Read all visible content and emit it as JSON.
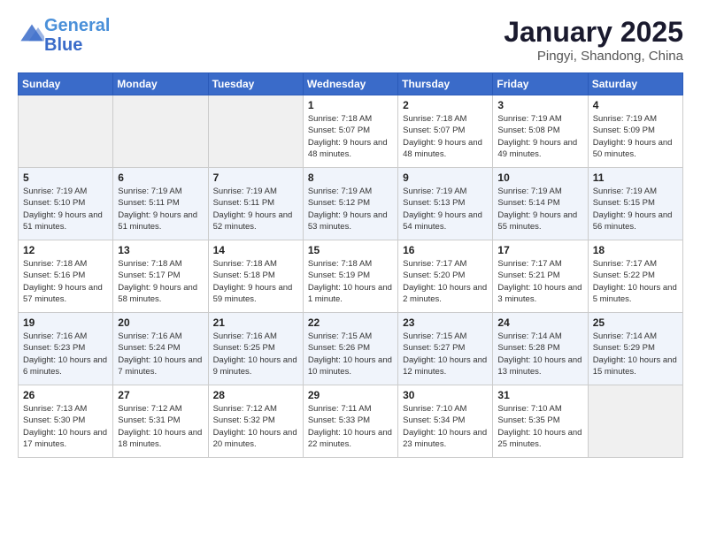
{
  "header": {
    "logo_line1": "General",
    "logo_line2": "Blue",
    "month": "January 2025",
    "location": "Pingyi, Shandong, China"
  },
  "days_of_week": [
    "Sunday",
    "Monday",
    "Tuesday",
    "Wednesday",
    "Thursday",
    "Friday",
    "Saturday"
  ],
  "weeks": [
    [
      {
        "day": "",
        "empty": true
      },
      {
        "day": "",
        "empty": true
      },
      {
        "day": "",
        "empty": true
      },
      {
        "day": "1",
        "sunrise": "7:18 AM",
        "sunset": "5:07 PM",
        "daylight": "9 hours and 48 minutes."
      },
      {
        "day": "2",
        "sunrise": "7:18 AM",
        "sunset": "5:07 PM",
        "daylight": "9 hours and 48 minutes."
      },
      {
        "day": "3",
        "sunrise": "7:19 AM",
        "sunset": "5:08 PM",
        "daylight": "9 hours and 49 minutes."
      },
      {
        "day": "4",
        "sunrise": "7:19 AM",
        "sunset": "5:09 PM",
        "daylight": "9 hours and 50 minutes."
      }
    ],
    [
      {
        "day": "5",
        "sunrise": "7:19 AM",
        "sunset": "5:10 PM",
        "daylight": "9 hours and 51 minutes."
      },
      {
        "day": "6",
        "sunrise": "7:19 AM",
        "sunset": "5:11 PM",
        "daylight": "9 hours and 51 minutes."
      },
      {
        "day": "7",
        "sunrise": "7:19 AM",
        "sunset": "5:11 PM",
        "daylight": "9 hours and 52 minutes."
      },
      {
        "day": "8",
        "sunrise": "7:19 AM",
        "sunset": "5:12 PM",
        "daylight": "9 hours and 53 minutes."
      },
      {
        "day": "9",
        "sunrise": "7:19 AM",
        "sunset": "5:13 PM",
        "daylight": "9 hours and 54 minutes."
      },
      {
        "day": "10",
        "sunrise": "7:19 AM",
        "sunset": "5:14 PM",
        "daylight": "9 hours and 55 minutes."
      },
      {
        "day": "11",
        "sunrise": "7:19 AM",
        "sunset": "5:15 PM",
        "daylight": "9 hours and 56 minutes."
      }
    ],
    [
      {
        "day": "12",
        "sunrise": "7:18 AM",
        "sunset": "5:16 PM",
        "daylight": "9 hours and 57 minutes."
      },
      {
        "day": "13",
        "sunrise": "7:18 AM",
        "sunset": "5:17 PM",
        "daylight": "9 hours and 58 minutes."
      },
      {
        "day": "14",
        "sunrise": "7:18 AM",
        "sunset": "5:18 PM",
        "daylight": "9 hours and 59 minutes."
      },
      {
        "day": "15",
        "sunrise": "7:18 AM",
        "sunset": "5:19 PM",
        "daylight": "10 hours and 1 minute."
      },
      {
        "day": "16",
        "sunrise": "7:17 AM",
        "sunset": "5:20 PM",
        "daylight": "10 hours and 2 minutes."
      },
      {
        "day": "17",
        "sunrise": "7:17 AM",
        "sunset": "5:21 PM",
        "daylight": "10 hours and 3 minutes."
      },
      {
        "day": "18",
        "sunrise": "7:17 AM",
        "sunset": "5:22 PM",
        "daylight": "10 hours and 5 minutes."
      }
    ],
    [
      {
        "day": "19",
        "sunrise": "7:16 AM",
        "sunset": "5:23 PM",
        "daylight": "10 hours and 6 minutes."
      },
      {
        "day": "20",
        "sunrise": "7:16 AM",
        "sunset": "5:24 PM",
        "daylight": "10 hours and 7 minutes."
      },
      {
        "day": "21",
        "sunrise": "7:16 AM",
        "sunset": "5:25 PM",
        "daylight": "10 hours and 9 minutes."
      },
      {
        "day": "22",
        "sunrise": "7:15 AM",
        "sunset": "5:26 PM",
        "daylight": "10 hours and 10 minutes."
      },
      {
        "day": "23",
        "sunrise": "7:15 AM",
        "sunset": "5:27 PM",
        "daylight": "10 hours and 12 minutes."
      },
      {
        "day": "24",
        "sunrise": "7:14 AM",
        "sunset": "5:28 PM",
        "daylight": "10 hours and 13 minutes."
      },
      {
        "day": "25",
        "sunrise": "7:14 AM",
        "sunset": "5:29 PM",
        "daylight": "10 hours and 15 minutes."
      }
    ],
    [
      {
        "day": "26",
        "sunrise": "7:13 AM",
        "sunset": "5:30 PM",
        "daylight": "10 hours and 17 minutes."
      },
      {
        "day": "27",
        "sunrise": "7:12 AM",
        "sunset": "5:31 PM",
        "daylight": "10 hours and 18 minutes."
      },
      {
        "day": "28",
        "sunrise": "7:12 AM",
        "sunset": "5:32 PM",
        "daylight": "10 hours and 20 minutes."
      },
      {
        "day": "29",
        "sunrise": "7:11 AM",
        "sunset": "5:33 PM",
        "daylight": "10 hours and 22 minutes."
      },
      {
        "day": "30",
        "sunrise": "7:10 AM",
        "sunset": "5:34 PM",
        "daylight": "10 hours and 23 minutes."
      },
      {
        "day": "31",
        "sunrise": "7:10 AM",
        "sunset": "5:35 PM",
        "daylight": "10 hours and 25 minutes."
      },
      {
        "day": "",
        "empty": true
      }
    ]
  ]
}
